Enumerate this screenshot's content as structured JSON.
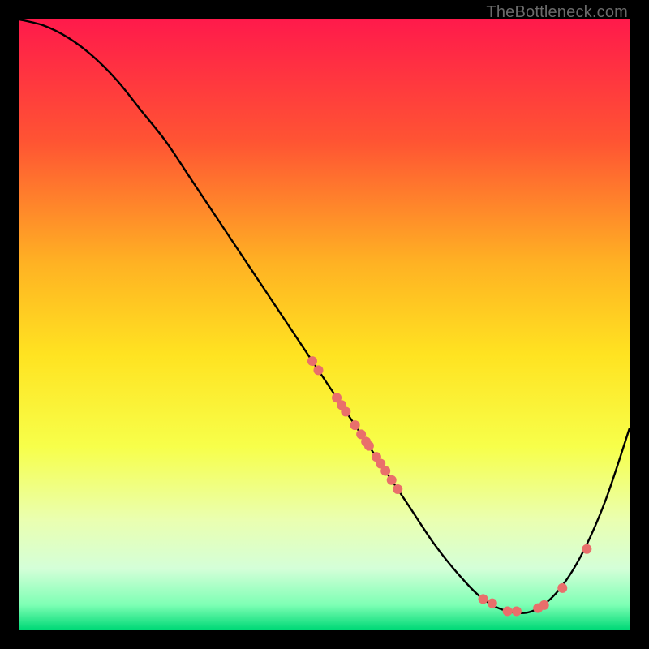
{
  "watermark": "TheBottleneck.com",
  "chart_data": {
    "type": "line",
    "title": "",
    "xlabel": "",
    "ylabel": "",
    "xlim": [
      0,
      100
    ],
    "ylim": [
      0,
      100
    ],
    "grid": false,
    "legend": false,
    "background_gradient": {
      "stops": [
        {
          "offset": 0,
          "color": "#ff1a4b"
        },
        {
          "offset": 20,
          "color": "#ff5433"
        },
        {
          "offset": 40,
          "color": "#ffb223"
        },
        {
          "offset": 55,
          "color": "#ffe321"
        },
        {
          "offset": 70,
          "color": "#f7ff4a"
        },
        {
          "offset": 82,
          "color": "#eaffb0"
        },
        {
          "offset": 90,
          "color": "#d4ffd8"
        },
        {
          "offset": 96,
          "color": "#7dffb4"
        },
        {
          "offset": 100,
          "color": "#00d977"
        }
      ]
    },
    "series": [
      {
        "name": "curve",
        "x": [
          0,
          4,
          8,
          12,
          16,
          20,
          24,
          28,
          32,
          36,
          40,
          44,
          48,
          52,
          56,
          60,
          64,
          68,
          72,
          76,
          80,
          84,
          88,
          92,
          96,
          100
        ],
        "y": [
          100,
          99,
          97,
          94,
          90,
          85,
          80,
          74,
          68,
          62,
          56,
          50,
          44,
          38,
          32,
          26,
          20,
          14,
          9,
          5,
          3,
          3,
          6,
          12,
          21,
          33
        ]
      }
    ],
    "scatter": {
      "name": "highlight-points",
      "color": "#e96f6b",
      "radius": 6,
      "points": [
        {
          "x": 48.0,
          "y": 44.0
        },
        {
          "x": 49.0,
          "y": 42.5
        },
        {
          "x": 52.0,
          "y": 38.0
        },
        {
          "x": 52.8,
          "y": 36.8
        },
        {
          "x": 53.5,
          "y": 35.7
        },
        {
          "x": 55.0,
          "y": 33.5
        },
        {
          "x": 56.0,
          "y": 32.0
        },
        {
          "x": 56.8,
          "y": 30.8
        },
        {
          "x": 57.3,
          "y": 30.1
        },
        {
          "x": 58.5,
          "y": 28.3
        },
        {
          "x": 59.2,
          "y": 27.2
        },
        {
          "x": 60.0,
          "y": 26.0
        },
        {
          "x": 61.0,
          "y": 24.5
        },
        {
          "x": 62.0,
          "y": 23.0
        },
        {
          "x": 76.0,
          "y": 5.0
        },
        {
          "x": 77.5,
          "y": 4.3
        },
        {
          "x": 80.0,
          "y": 3.0
        },
        {
          "x": 81.5,
          "y": 3.0
        },
        {
          "x": 85.0,
          "y": 3.5
        },
        {
          "x": 86.0,
          "y": 4.0
        },
        {
          "x": 89.0,
          "y": 6.8
        },
        {
          "x": 93.0,
          "y": 13.2
        }
      ]
    }
  }
}
